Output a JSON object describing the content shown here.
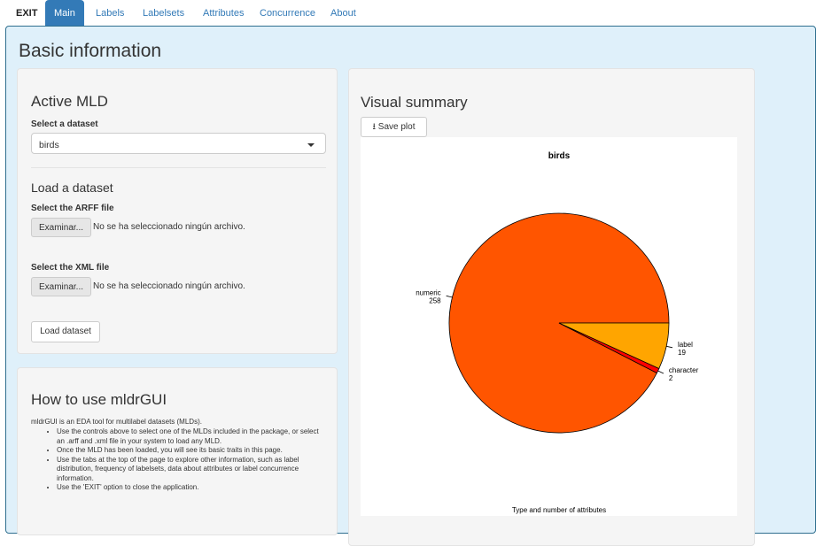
{
  "nav": {
    "exit": "EXIT",
    "tabs": [
      "Main",
      "Labels",
      "Labelsets",
      "Attributes",
      "Concurrence",
      "About"
    ],
    "active_tab": "Main"
  },
  "page": {
    "title": "Basic information"
  },
  "active_mld": {
    "title": "Active MLD",
    "select_label": "Select a dataset",
    "selected_dataset": "birds"
  },
  "load_dataset": {
    "title": "Load a dataset",
    "arff_label": "Select the ARFF file",
    "xml_label": "Select the XML file",
    "browse_label": "Examinar...",
    "no_file_text": "No se ha seleccionado ningún archivo.",
    "load_button": "Load dataset"
  },
  "help": {
    "title": "How to use mldrGUI",
    "intro": "mldrGUI is an EDA tool for multilabel datasets (MLDs).",
    "items": [
      "Use the controls above to select one of the MLDs included in the package, or select an .arff and .xml file in your system to load any MLD.",
      "Once the MLD has been loaded, you will see its basic traits in this page.",
      "Use the tabs at the top of the page to explore other information, such as label distribution, frequency of labelsets, data about attributes or label concurrence information.",
      "Use the 'EXIT' option to close the application."
    ]
  },
  "visual_summary": {
    "title": "Visual summary",
    "save_button": "Save plot"
  },
  "chart_data": {
    "type": "pie",
    "title": "birds",
    "caption": "Type and number of attributes",
    "categories": [
      "numeric",
      "character",
      "label"
    ],
    "values": [
      258,
      2,
      19
    ],
    "colors": [
      "#ff5500",
      "#ff0000",
      "#ffa500"
    ]
  }
}
